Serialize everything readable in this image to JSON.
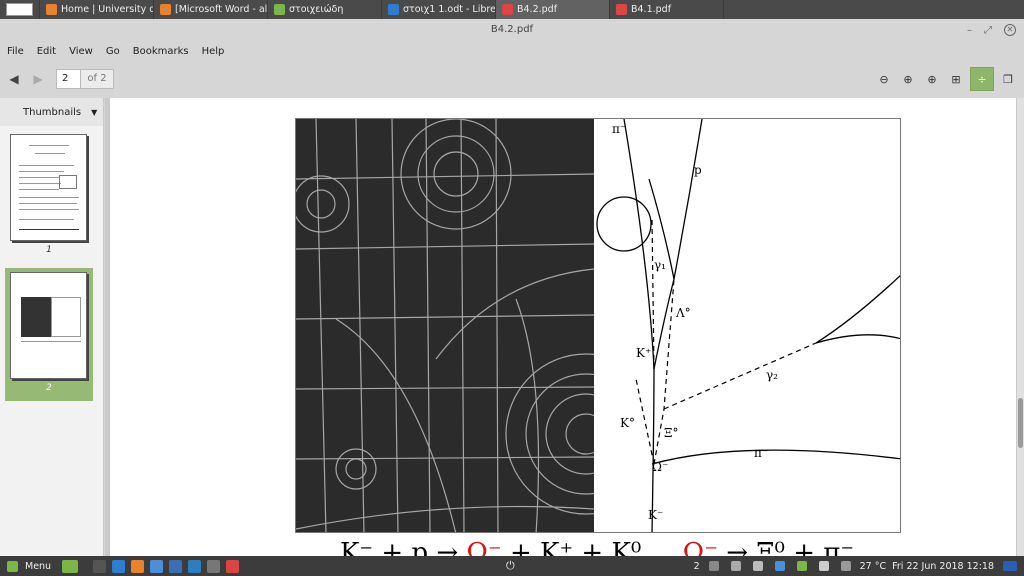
{
  "taskbar": {
    "tasks": [
      {
        "label": "Home | University o...",
        "color": "#e8832b"
      },
      {
        "label": "[Microsoft Word - ali...",
        "color": "#e8832b"
      },
      {
        "label": "στοιχειώδη",
        "color": "#7ab648"
      },
      {
        "label": "στοιχ1 1.odt - Libre...",
        "color": "#2a7fd4"
      },
      {
        "label": "B4.2.pdf",
        "color": "#d44"
      },
      {
        "label": "B4.1.pdf",
        "color": "#d44"
      }
    ]
  },
  "window": {
    "title": "B4.2.pdf",
    "minimize": "–",
    "restore": "⤢",
    "close": "✕"
  },
  "menu": {
    "items": [
      "File",
      "Edit",
      "View",
      "Go",
      "Bookmarks",
      "Help"
    ]
  },
  "toolbar": {
    "back": "◀",
    "forward": "▶",
    "page_value": "2",
    "page_total": "of 2",
    "zoom_out": "⊖",
    "zoom_fit": "⊕",
    "zoom_in": "⊕",
    "grid": "⊞",
    "continuous": "÷",
    "dual": "❐"
  },
  "sidebar": {
    "header": "Thumbnails",
    "dropdown": "▼",
    "thumbs": [
      {
        "label": "1"
      },
      {
        "label": "2"
      }
    ]
  },
  "document": {
    "diagram_labels": {
      "pi_top": "π⁻",
      "p": "p",
      "gamma1": "γ₁",
      "lambda0": "Λ°",
      "kplus": "K⁺",
      "gamma2": "γ₂",
      "k0": "K°",
      "xi0": "Ξ°",
      "pi_right": "π⁻",
      "omega": "Ω⁻",
      "kminus": "K⁻"
    },
    "equation": {
      "part1": "K⁻ + p → ",
      "red1": "Ω⁻",
      "part2": " + K⁺ + K⁰ ... ",
      "red2": "Ω⁻",
      "part3": " → Ξ⁰ + π⁻"
    }
  },
  "panel": {
    "menu_label": "Menu",
    "power": "⏻",
    "updates": "2",
    "weather": "27 °C",
    "datetime": "Fri 22 Jun 2018 12:18"
  }
}
